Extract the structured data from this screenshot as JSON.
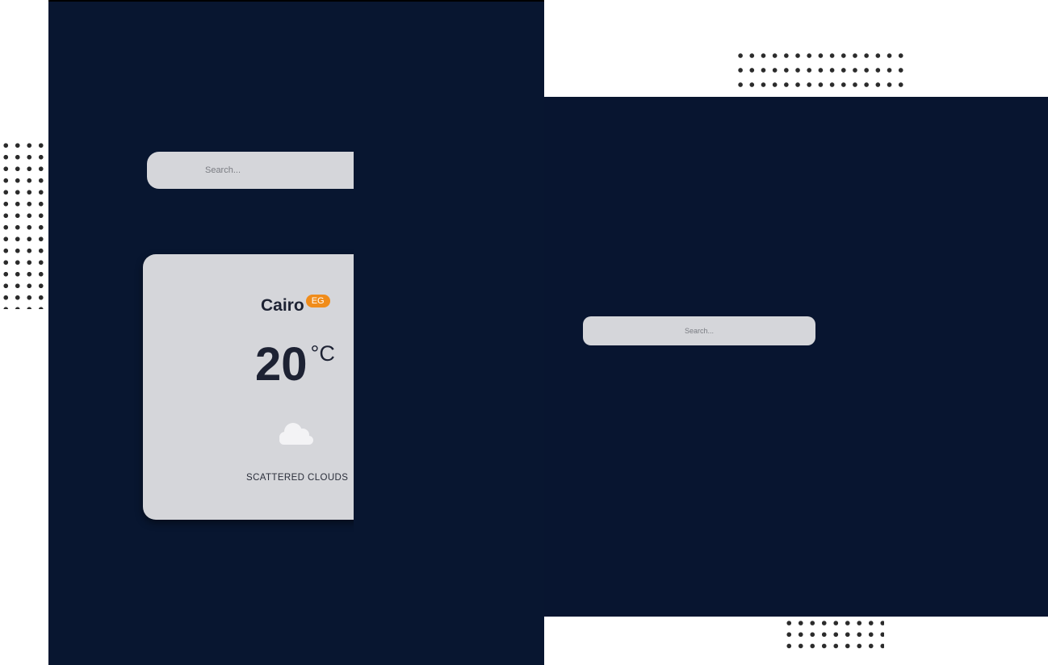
{
  "left_screen": {
    "search": {
      "placeholder": "Search..."
    },
    "weather": {
      "city": "Cairo",
      "country": "EG",
      "temperature": "20",
      "unit": "°C",
      "description": "SCATTERED CLOUDS",
      "icon": "cloud-icon"
    }
  },
  "right_screen": {
    "search": {
      "placeholder": "Search..."
    }
  },
  "colors": {
    "background": "#081630",
    "card": "#d5d6da",
    "badge": "#f08c1a",
    "text": "#1d2233"
  }
}
